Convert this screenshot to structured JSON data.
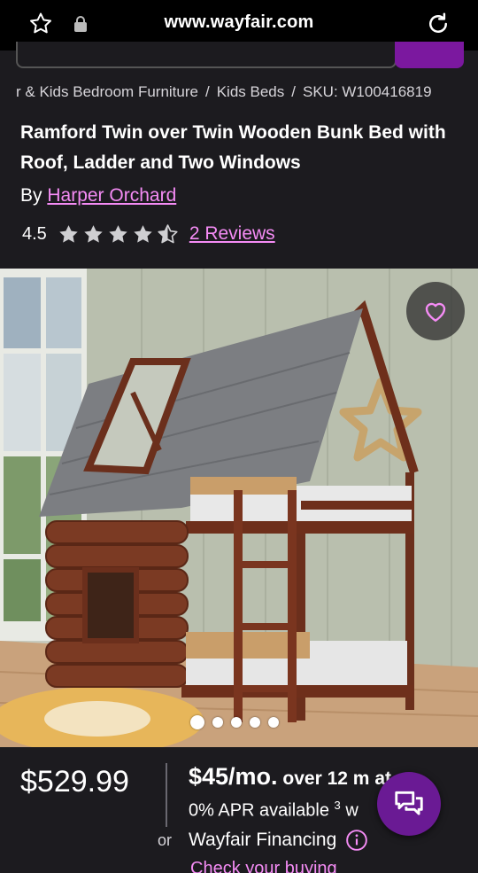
{
  "browser": {
    "url": "www.wayfair.com",
    "icons": [
      "star-icon",
      "lock-icon",
      "reload-icon"
    ]
  },
  "breadcrumb": {
    "items": [
      "r & Kids Bedroom Furniture",
      "Kids Beds",
      "SKU: W100416819"
    ],
    "separator": "/"
  },
  "product": {
    "title": "Ramford Twin over Twin Wooden Bunk Bed with Roof, Ladder and Two Windows",
    "by_label": "By",
    "brand": "Harper Orchard",
    "rating": "4.5",
    "stars_value": 4.5,
    "stars_max": 5,
    "reviews_link": "2 Reviews"
  },
  "gallery": {
    "image_count": 5,
    "active_index": 0,
    "favorite_icon": "heart-icon"
  },
  "pricing": {
    "price": "$529.99",
    "or_label": "or",
    "monthly_amount": "$45/mo.",
    "monthly_terms": "over 12 m",
    "monthly_tail": "at",
    "apr_text": "0% APR available",
    "apr_sup": "3",
    "apr_tail": "w",
    "financing": "Wayfair Financing",
    "check_buying": "Check your buying"
  },
  "colors": {
    "accent": "#f58cf5",
    "brand_purple": "#7b189f",
    "chat_purple": "#6a1a94",
    "background": "#1c1b1f"
  }
}
